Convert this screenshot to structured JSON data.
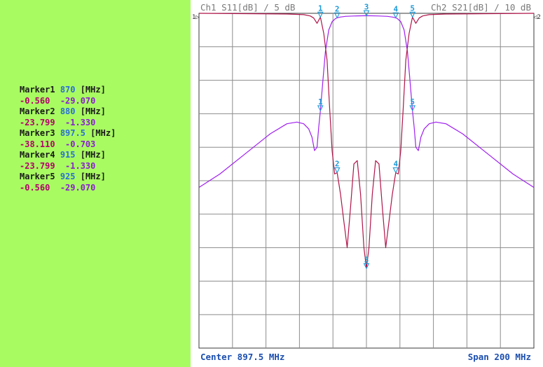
{
  "colors": {
    "side_panel": "#a8fb61",
    "grid": "#8c8c8c",
    "s11_trace": "#b0144a",
    "s21_trace": "#a020f0",
    "marker": "#1e9bd7",
    "header_text": "#7a7a7a",
    "footer_text": "#1c4fb0"
  },
  "header": {
    "ch1": "Ch1 S11[dB] / 5 dB",
    "ch2": "Ch2 S21[dB] / 10 dB"
  },
  "footer": {
    "center": "Center 897.5 MHz",
    "span": "Span 200 MHz"
  },
  "markers": [
    {
      "name": "Marker1",
      "freq": "870",
      "unit": "[MHz]",
      "s11": "-0.560",
      "s21": "-29.070"
    },
    {
      "name": "Marker2",
      "freq": "880",
      "unit": "[MHz]",
      "s11": "-23.799",
      "s21": "-1.330"
    },
    {
      "name": "Marker3",
      "freq": "897.5",
      "unit": "[MHz]",
      "s11": "-38.110",
      "s21": "-0.703"
    },
    {
      "name": "Marker4",
      "freq": "915",
      "unit": "[MHz]",
      "s11": "-23.799",
      "s21": "-1.330"
    },
    {
      "name": "Marker5",
      "freq": "925",
      "unit": "[MHz]",
      "s11": "-0.560",
      "s21": "-29.070"
    }
  ],
  "chart_data": {
    "type": "line",
    "x_unit": "MHz",
    "xlim": [
      797.5,
      997.5
    ],
    "s11_ylim": [
      -50,
      0
    ],
    "s21_ylim": [
      -100,
      0
    ],
    "grid": true,
    "series": [
      {
        "trace": "S11",
        "x": [
          797.5,
          850,
          860,
          864,
          866,
          868,
          870,
          872,
          874,
          875.5,
          877,
          878.5,
          880,
          882,
          884,
          886,
          888,
          890,
          892,
          894,
          896,
          897.5,
          899,
          901,
          903,
          905,
          907,
          909,
          911,
          913,
          915,
          916.5,
          918,
          919.5,
          921,
          923,
          925,
          927,
          929,
          931,
          935,
          945,
          997.5
        ],
        "values": [
          0,
          -0.1,
          -0.2,
          -0.4,
          -0.7,
          -1.5,
          -0.56,
          -3.0,
          -7.0,
          -14.0,
          -20.5,
          -24.0,
          -23.8,
          -27.0,
          -31.0,
          -35.0,
          -29.0,
          -22.5,
          -22.0,
          -27.0,
          -35.0,
          -38.11,
          -35.0,
          -27.0,
          -22.0,
          -22.5,
          -29.0,
          -35.0,
          -31.0,
          -27.0,
          -23.8,
          -24.0,
          -20.5,
          -14.0,
          -7.0,
          -3.0,
          -0.56,
          -1.5,
          -0.7,
          -0.4,
          -0.2,
          -0.1,
          0
        ]
      },
      {
        "trace": "S21",
        "x": [
          797.5,
          810,
          825,
          840,
          850,
          856,
          860,
          863,
          865,
          866.5,
          868,
          869,
          870,
          871.5,
          873,
          875,
          877,
          879,
          880,
          882,
          885,
          890,
          897.5,
          905,
          910,
          913,
          915,
          916,
          918,
          920,
          922,
          923.5,
          925,
          926,
          927,
          928.5,
          930,
          932,
          935,
          939,
          945,
          955,
          970,
          985,
          997.5
        ],
        "values": [
          -52.0,
          -48.0,
          -42.0,
          -36.0,
          -33.0,
          -32.5,
          -33.0,
          -34.5,
          -37.0,
          -41.0,
          -40.0,
          -34.0,
          -29.07,
          -20.0,
          -11.5,
          -5.0,
          -2.5,
          -1.6,
          -1.33,
          -1.1,
          -0.9,
          -0.8,
          -0.703,
          -0.8,
          -0.9,
          -1.1,
          -1.33,
          -1.6,
          -2.5,
          -5.0,
          -11.5,
          -20.0,
          -29.07,
          -34.0,
          -40.0,
          -41.0,
          -37.0,
          -34.5,
          -33.0,
          -32.5,
          -33.0,
          -36.0,
          -42.0,
          -48.0,
          -52.0
        ]
      }
    ]
  }
}
